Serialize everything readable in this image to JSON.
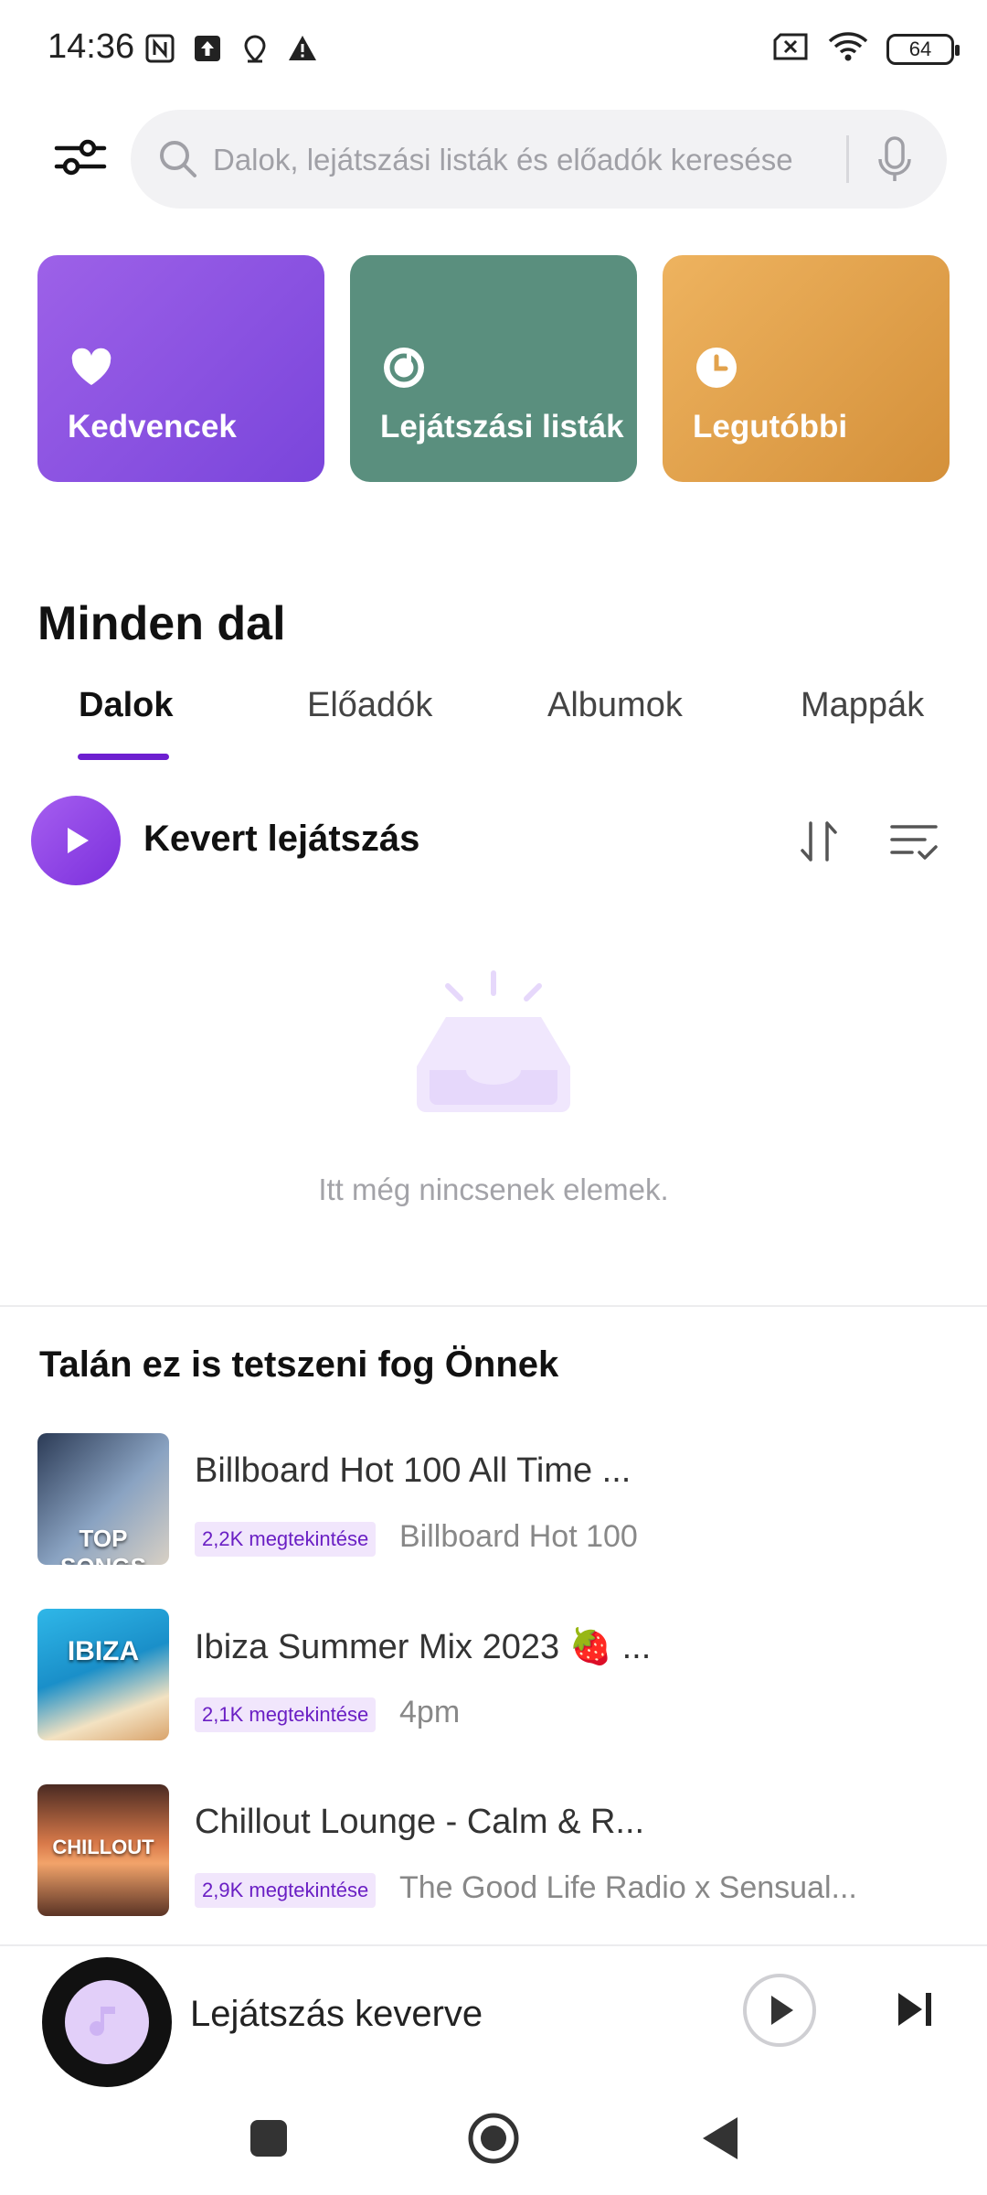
{
  "status_bar": {
    "time": "14:36",
    "battery": "64"
  },
  "search": {
    "placeholder": "Dalok, lejátszási listák és előadók keresése"
  },
  "tiles": {
    "favorites": "Kedvencek",
    "playlists": "Lejátszási listák",
    "recent": "Legutóbbi"
  },
  "section": {
    "title": "Minden dal"
  },
  "tabs": [
    {
      "label": "Dalok",
      "active": true
    },
    {
      "label": "Előadók",
      "active": false
    },
    {
      "label": "Albumok",
      "active": false
    },
    {
      "label": "Mappák",
      "active": false
    }
  ],
  "shuffle": {
    "label": "Kevert lejátszás"
  },
  "empty_state": {
    "text": "Itt még nincsenek elemek."
  },
  "recommendations": {
    "title": "Talán ez is tetszeni fog Önnek",
    "items": [
      {
        "name": "Billboard Hot 100 All Time ...",
        "views": "2,2K megtekintése",
        "artist": "Billboard Hot 100",
        "thumb_text": "TOP SONGS"
      },
      {
        "name": "Ibiza Summer Mix 2023 🍓 ...",
        "views": "2,1K megtekintése",
        "artist": "4pm",
        "thumb_text": "IBIZA"
      },
      {
        "name": "Chillout Lounge - Calm & R...",
        "views": "2,9K megtekintése",
        "artist": "The Good Life Radio x Sensual...",
        "thumb_text": "CHILLOUT"
      }
    ]
  },
  "mini_player": {
    "label": "Lejátszás keverve"
  },
  "colors": {
    "accent": "#6d1fd0",
    "favorites_tile": "#8a52e2",
    "playlists_tile": "#5a8f7e",
    "recent_tile": "#e2a24c"
  }
}
